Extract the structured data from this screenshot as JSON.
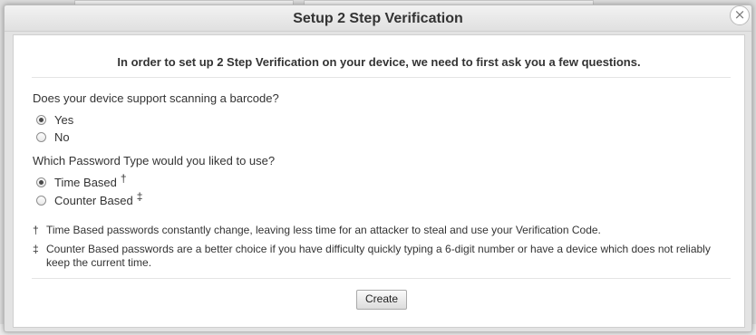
{
  "dialog": {
    "title": "Setup 2 Step Verification",
    "close_glyph": "×",
    "intro": "In order to set up 2 Step Verification on your device, we need to first ask you a few questions."
  },
  "questions": {
    "barcode": {
      "label": "Does your device support scanning a barcode?",
      "options": [
        {
          "label": "Yes",
          "checked": true
        },
        {
          "label": "No",
          "checked": false
        }
      ]
    },
    "password_type": {
      "label": "Which Password Type would you liked to use?",
      "options": [
        {
          "label": "Time Based",
          "mark": "†",
          "checked": true
        },
        {
          "label": "Counter Based",
          "mark": "‡",
          "checked": false
        }
      ]
    }
  },
  "notes": [
    {
      "symbol": "†",
      "text": "Time Based passwords constantly change, leaving less time for an attacker to steal and use your Verification Code."
    },
    {
      "symbol": "‡",
      "text": "Counter Based passwords are a better choice if you have difficulty quickly typing a 6-digit number or have a device which does not reliably keep the current time."
    }
  ],
  "actions": {
    "create_label": "Create"
  }
}
